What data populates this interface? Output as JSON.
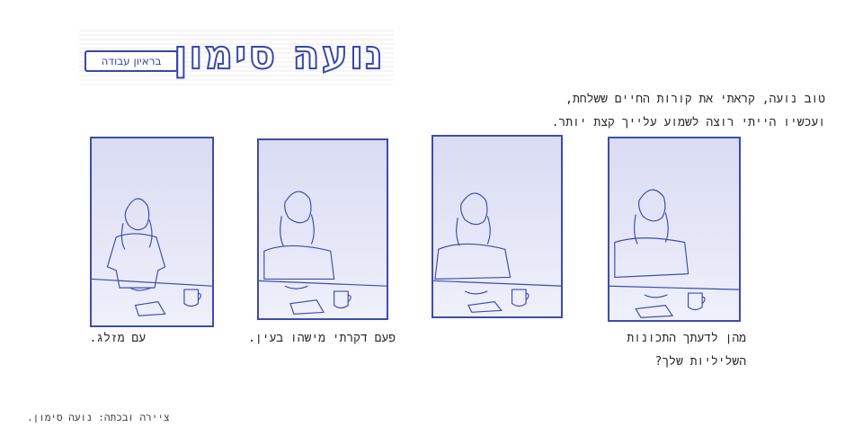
{
  "header": {
    "title": "נועה סימון",
    "subtitle": "בראיון עבודה"
  },
  "intro": {
    "line1": "טוב נועה, קראתי את קורות החיים ששלחת,",
    "line2": "ועכשיו הייתי רוצה לשמוע עלייך קצת יותר."
  },
  "captions": {
    "panel4_line1": "מהן לדעתך התכונות",
    "panel4_line2": "השליליות שלך?",
    "panel2": "פעם דקרתי מישהו בעין.",
    "panel1": "עם מזלג."
  },
  "credit": "ציירה ובכתה: נועה סימון.",
  "colors": {
    "ink": "#3f4cab",
    "panel_fill": "#dfe2f5",
    "text": "#262626"
  }
}
